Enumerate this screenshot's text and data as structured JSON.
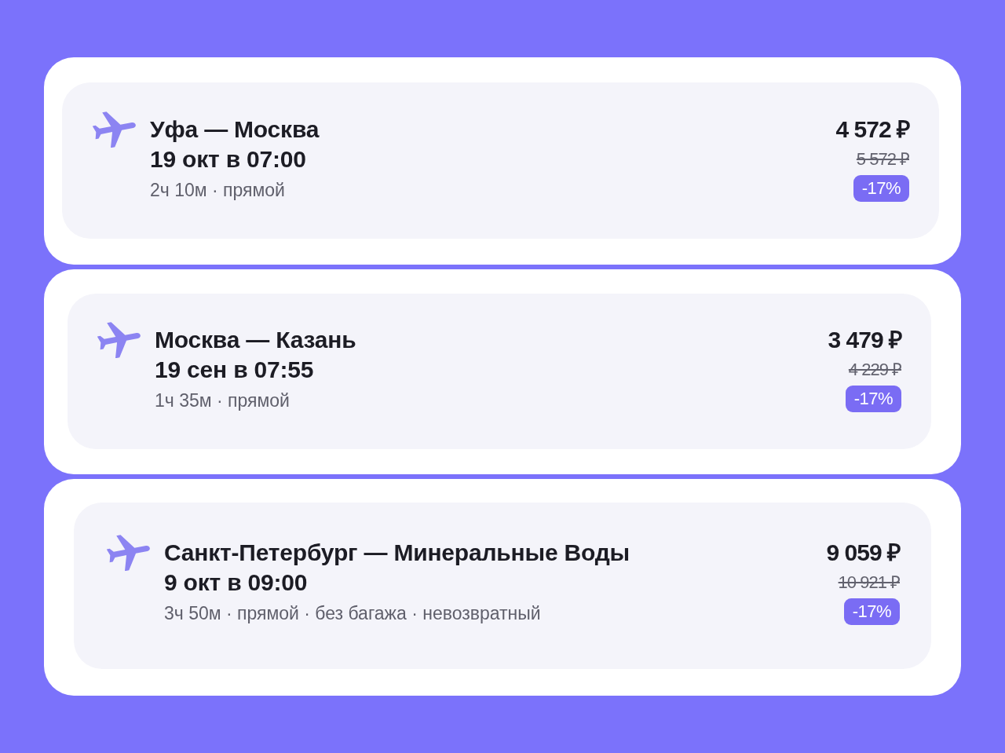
{
  "flights": [
    {
      "route": "Уфа — Москва",
      "departure": "19 окт в 07:00",
      "details": "2ч 10м · прямой",
      "price": "4 572 ₽",
      "old_price": "5 572 ₽",
      "discount": "-17%"
    },
    {
      "route": "Москва — Казань",
      "departure": "19 сен в 07:55",
      "details": "1ч 35м · прямой",
      "price": "3 479 ₽",
      "old_price": "4 229 ₽",
      "discount": "-17%"
    },
    {
      "route": "Санкт-Петербург — Минеральные Воды",
      "departure": "9 окт в 09:00",
      "details": "3ч 50м · прямой · без багажа · невозвратный",
      "price": "9 059 ₽",
      "old_price": "10 921 ₽",
      "discount": "-17%"
    }
  ]
}
